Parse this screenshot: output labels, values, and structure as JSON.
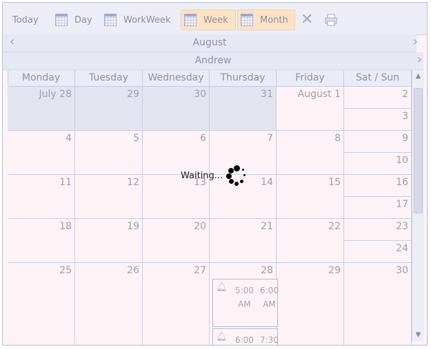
{
  "toolbar": {
    "today": "Today",
    "day": "Day",
    "workweek": "WorkWeek",
    "week": "Week",
    "month": "Month"
  },
  "nav": {
    "month": "August",
    "resource": "Andrew"
  },
  "day_headers": [
    "Monday",
    "Tuesday",
    "Wednesday",
    "Thursday",
    "Friday",
    "Sat / Sun"
  ],
  "weeks": [
    {
      "days": [
        "July 28",
        "29",
        "30",
        "31",
        "August 1"
      ],
      "sat": "2",
      "sun": "3"
    },
    {
      "days": [
        "4",
        "5",
        "6",
        "7",
        "8"
      ],
      "sat": "9",
      "sun": "10"
    },
    {
      "days": [
        "11",
        "12",
        "13",
        "14",
        "15"
      ],
      "sat": "16",
      "sun": "17"
    },
    {
      "days": [
        "18",
        "19",
        "20",
        "21",
        "22"
      ],
      "sat": "23",
      "sun": "24"
    },
    {
      "days": [
        "25",
        "26",
        "27",
        "28",
        "29"
      ],
      "sat": "30",
      "sun": ""
    }
  ],
  "appointments": [
    {
      "start": "5:00 AM",
      "end": "6:00 AM",
      "start_a": "5:00",
      "start_b": "AM",
      "end_a": "6:00",
      "end_b": "AM"
    },
    {
      "start": "6:00",
      "end": "7:30",
      "start_a": "6:00",
      "start_b": "",
      "end_a": "7:30",
      "end_b": ""
    }
  ],
  "loading": {
    "text": "Waiting..."
  },
  "colors": {
    "prev_month_bg": "#e3e4ef",
    "cell_bg": "#fdf3f6",
    "active_view_bg": "#fde3c6"
  }
}
